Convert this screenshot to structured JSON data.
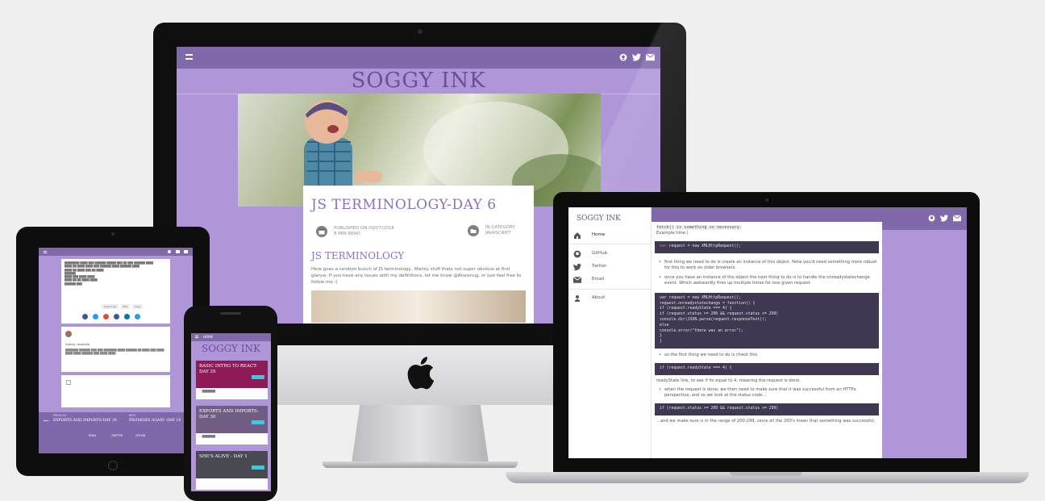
{
  "imac": {
    "site_title": "SOGGY INK",
    "post_title": "JS TERMINOLOGY-DAY 6",
    "published": "PUBLISHED ON 09/07/2018",
    "read_time": "8 MIN READ",
    "category_label": "IN CATEGORY",
    "category": "JAVASCRIPT",
    "section_heading": "JS TERMINOLOGY",
    "intro": "Here goes a random bunch of JS terminology.. Mainly stuff thats not super obvious at first glance. If you have any issues with my definitions, let me know @Anaisnug, or just feel free to follow me :)"
  },
  "laptop": {
    "site_title": "SOGGY INK",
    "nav": [
      {
        "label": "Home",
        "icon": "home-icon"
      },
      {
        "label": "GitHub",
        "icon": "github-icon"
      },
      {
        "label": "Twitter",
        "icon": "twitter-icon"
      },
      {
        "label": "Email",
        "icon": "email-icon"
      },
      {
        "label": "About",
        "icon": "user-icon"
      }
    ],
    "top_text": "fetch() is something so necessary.",
    "example_label": "Example time:)",
    "code1_kw": "var",
    "code1_rest": " request = new XMLHttpRequest();",
    "bullet1": "first thing we need to do is create an instance of this object. Note you'd need something more robust for this to work on older browsers.",
    "bullet2": "once you have an instance of the object the next thing to do is to handle the onreadystatechange event. Which awkwardly fires up multiple times for one given request",
    "code2": [
      "var request = new XMLHttpRequest();",
      "request.onreadystatechange = function() {",
      "    if (request.readyState === 4) {",
      "        if (request.status >= 200 && request.status <= 299)",
      "            console.dir(JSON.parse(request.responseText));",
      "        else",
      "            console.error(\"there was an error\");",
      "    }",
      "}"
    ],
    "bullet3": "so the first thing we need to do is check this",
    "code3": "if (request.readyState === 4) {",
    "text_after3": "readyState line, to see if its equal to 4, meaning the request is done.",
    "bullet4": "when the request is done, we then need to make sure that it was successful from an HTTPs perspective, and so we look at the status code...",
    "code4": "if (request.status >= 200 && request.status <= 299)",
    "bottom_text": "...and we make sure is in the range of 200-299, since all the 200's mean that something was successful."
  },
  "ipad": {
    "prev_label": "PREVIOUS",
    "prev_title": "EXPORTS AND IMPORTS-DAY 30",
    "next_label": "NEXT",
    "next_title": "PROMISES AGAIN -DAY 19",
    "footer_links": [
      "EMAIL",
      "TWITTER",
      "GITHUB"
    ],
    "comment_name": "Sydney, Australia",
    "tags": [
      "javascript",
      "ES6",
      "blog"
    ]
  },
  "iphone": {
    "nav_label": "HOME",
    "site_title": "SOGGY INK",
    "cards": [
      {
        "title": "BASIC INTRO TO REACT-DAY 29",
        "bg": "#8e1b56"
      },
      {
        "title": "EXPORTS AND IMPORTS-DAY 30",
        "bg": "#6f5d84"
      },
      {
        "title": "SHE'S ALIVE - DAY 1",
        "bg": "#4a4a55"
      }
    ]
  },
  "colors": {
    "nav_purple": "#8069ab",
    "page_purple": "#ae96d9",
    "accent": "#23d3e0"
  }
}
